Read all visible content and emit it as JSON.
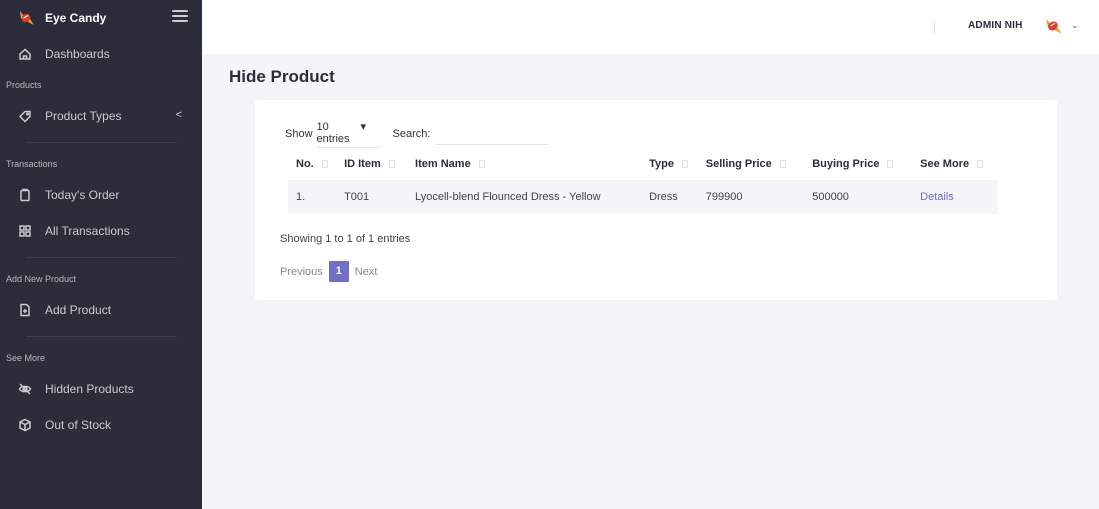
{
  "brand": {
    "name": "Eye Candy"
  },
  "sidebar": {
    "items": [
      {
        "type": "item",
        "label": "Dashboards",
        "icon": "home-icon"
      },
      {
        "type": "section",
        "label": "Products"
      },
      {
        "type": "item",
        "label": "Product Types",
        "icon": "tag-icon",
        "caret": "<"
      },
      {
        "type": "section",
        "label": "Transactions"
      },
      {
        "type": "item",
        "label": "Today's Order",
        "icon": "clipboard-icon"
      },
      {
        "type": "item",
        "label": "All Transactions",
        "icon": "grid-icon"
      },
      {
        "type": "section",
        "label": "Add New Product"
      },
      {
        "type": "item",
        "label": "Add Product",
        "icon": "file-add-icon"
      },
      {
        "type": "section",
        "label": "See More"
      },
      {
        "type": "item",
        "label": "Hidden Products",
        "icon": "eye-off-icon"
      },
      {
        "type": "item",
        "label": "Out of Stock",
        "icon": "box-icon"
      }
    ]
  },
  "topbar": {
    "user_name": "ADMIN NIH",
    "chevron": "⌄"
  },
  "page": {
    "title": "Hide Product"
  },
  "table_controls": {
    "show_label": "Show",
    "show_value": "10",
    "entries_label": "▾ entries",
    "search_label": "Search:",
    "search_value": ""
  },
  "table": {
    "columns": [
      "No.",
      "ID Item",
      "Item Name",
      "Type",
      "Selling Price",
      "Buying Price",
      "See More"
    ],
    "rows": [
      [
        "1.",
        "T001",
        "Lyocell-blend Flounced Dress - Yellow",
        "Dress",
        "799900",
        "500000",
        "Details"
      ]
    ]
  },
  "table_info": "Showing 1 to 1 of 1 entries",
  "pagination": {
    "previous": "Previous",
    "current": "1",
    "next": "Next"
  },
  "colors": {
    "sidebar_bg": "#2b2d3a",
    "accent": "#6f6fc6",
    "page_bg": "#f4f5f8"
  }
}
